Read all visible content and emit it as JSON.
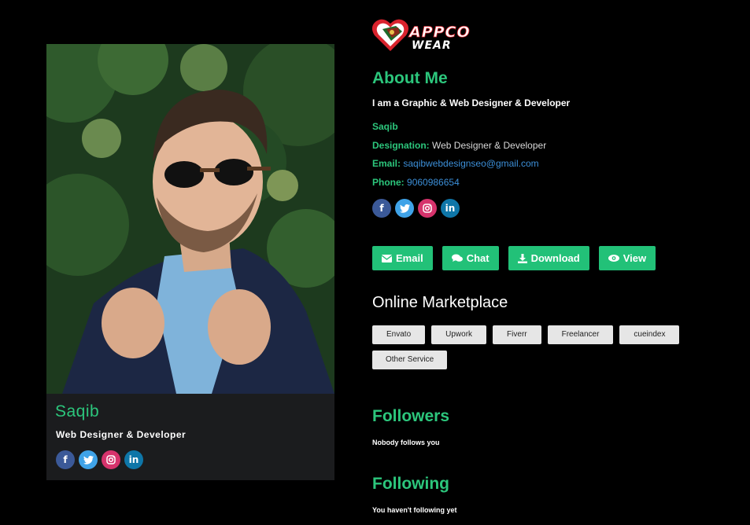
{
  "brand": {
    "logo_line1": "APPCO",
    "logo_line2": "WEAR",
    "colors": {
      "accent": "#2cc67c",
      "heart": "#d9232d",
      "link": "#3c8fd8"
    }
  },
  "card": {
    "photo": "portrait-photo",
    "name": "Saqib",
    "title": "Web Designer & Developer",
    "social": [
      "facebook-icon",
      "twitter-icon",
      "instagram-icon",
      "linkedin-icon"
    ]
  },
  "about": {
    "heading": "About Me",
    "tagline": "I am a Graphic & Web Designer & Developer",
    "name": "Saqib",
    "designation_label": "Designation:",
    "designation_value": "Web Designer & Developer",
    "email_label": "Email:",
    "email_value": "saqibwebdesignseo@gmail.com",
    "phone_label": "Phone:",
    "phone_value": "9060986654"
  },
  "actions": {
    "email": "Email",
    "chat": "Chat",
    "download": "Download",
    "view": "View"
  },
  "marketplace": {
    "heading": "Online Marketplace",
    "items": [
      "Envato",
      "Upwork",
      "Fiverr",
      "Freelancer",
      "cueindex",
      "Other Service"
    ]
  },
  "followers": {
    "heading": "Followers",
    "note": "Nobody follows you"
  },
  "following": {
    "heading": "Following",
    "note": "You haven't following yet"
  }
}
